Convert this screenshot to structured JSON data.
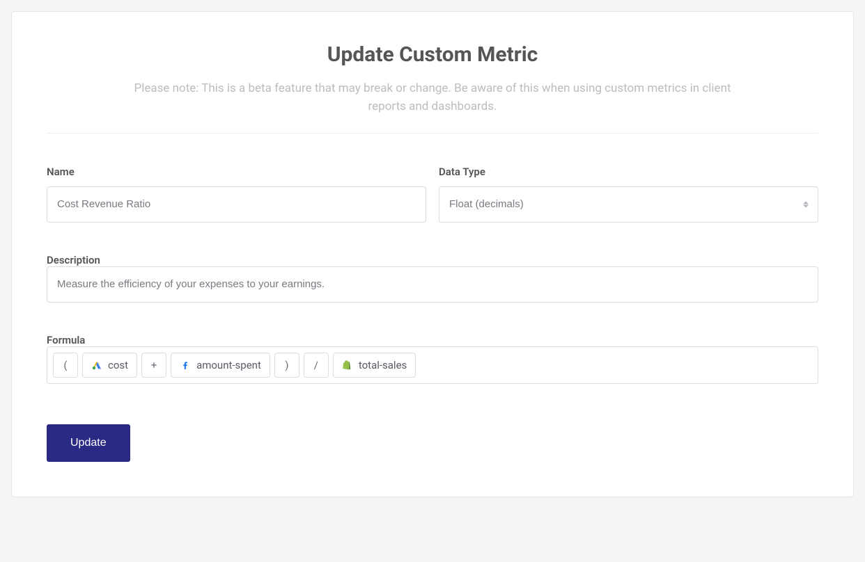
{
  "header": {
    "title": "Update Custom Metric",
    "note": "Please note: This is a beta feature that may break or change. Be aware of this when using custom metrics in client reports and dashboards."
  },
  "fields": {
    "name": {
      "label": "Name",
      "value": "Cost Revenue Ratio"
    },
    "data_type": {
      "label": "Data Type",
      "value": "Float (decimals)"
    },
    "description": {
      "label": "Description",
      "value": "Measure the efficiency of your expenses to your earnings."
    },
    "formula": {
      "label": "Formula",
      "tokens": [
        {
          "type": "op",
          "text": "("
        },
        {
          "type": "metric",
          "icon": "google-ads",
          "text": "cost"
        },
        {
          "type": "op",
          "text": "+"
        },
        {
          "type": "metric",
          "icon": "facebook",
          "text": "amount-spent"
        },
        {
          "type": "op",
          "text": ")"
        },
        {
          "type": "op",
          "text": "/"
        },
        {
          "type": "metric",
          "icon": "shopify",
          "text": "total-sales"
        }
      ]
    }
  },
  "actions": {
    "update_label": "Update"
  }
}
